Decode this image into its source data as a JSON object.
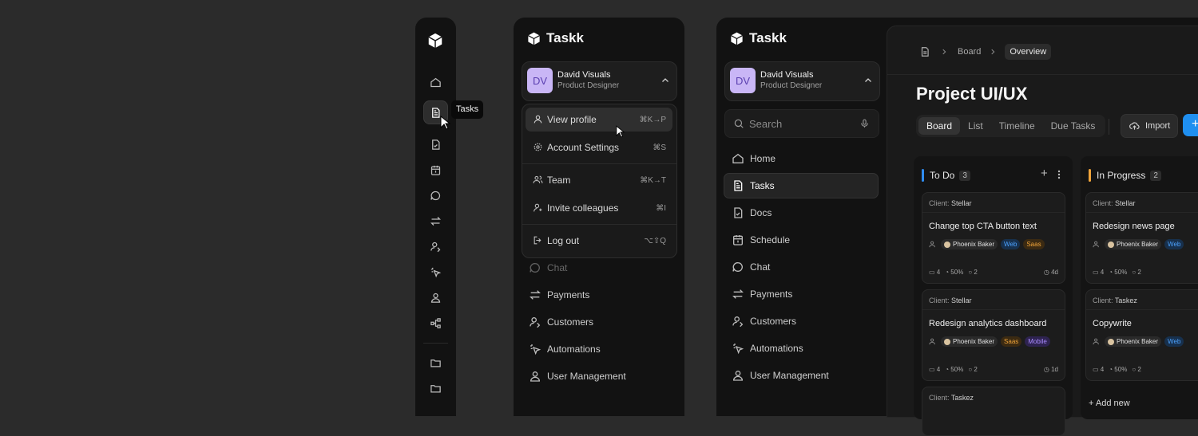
{
  "tooltip": "Tasks",
  "brand": {
    "name": "Taskk"
  },
  "account": {
    "initials": "DV",
    "name": "David Visuals",
    "role": "Product Designer"
  },
  "dropdown": [
    {
      "label": "View profile",
      "shortcut": "⌘K→P"
    },
    {
      "label": "Account Settings",
      "shortcut": "⌘S"
    },
    {
      "label": "Team",
      "shortcut": "⌘K→T"
    },
    {
      "label": "Invite colleagues",
      "shortcut": "⌘I"
    },
    {
      "label": "Log out",
      "shortcut": "⌥⇧Q"
    }
  ],
  "panel2_nav": [
    "Chat",
    "Payments",
    "Customers",
    "Automations",
    "User Management"
  ],
  "search": {
    "placeholder": "Search"
  },
  "nav": [
    "Home",
    "Tasks",
    "Docs",
    "Schedule",
    "Chat",
    "Payments",
    "Customers",
    "Automations",
    "User Management"
  ],
  "breadcrumb": [
    "Board",
    "Overview"
  ],
  "page_title": "Project UI/UX",
  "view_tabs": [
    "Board",
    "List",
    "Timeline",
    "Due Tasks"
  ],
  "import_label": "Import",
  "add_label": "+",
  "columns": [
    {
      "name": "To Do",
      "count": "3",
      "color": "#2f8cf0",
      "cards": [
        {
          "client_label": "Client:",
          "client": "Stellar",
          "title": "Change top CTA button text",
          "assignee": "Phoenix Baker",
          "tags": [
            {
              "label": "Web",
              "bg": "#17304d",
              "fg": "#4da3ff"
            },
            {
              "label": "Saas",
              "bg": "#3b2a12",
              "fg": "#f0a43a"
            }
          ],
          "files": "4",
          "progress": "50%",
          "comments": "2",
          "due": "4d"
        },
        {
          "client_label": "Client:",
          "client": "Stellar",
          "title": "Redesign analytics dashboard",
          "assignee": "Phoenix Baker",
          "tags": [
            {
              "label": "Saas",
              "bg": "#3b2a12",
              "fg": "#f0a43a"
            },
            {
              "label": "Mobile",
              "bg": "#2e2350",
              "fg": "#a98bff"
            }
          ],
          "files": "4",
          "progress": "50%",
          "comments": "2",
          "due": "1d"
        },
        {
          "client_label": "Client:",
          "client": "Taskez"
        }
      ]
    },
    {
      "name": "In Progress",
      "count": "2",
      "color": "#f0a43a",
      "cards": [
        {
          "client_label": "Client:",
          "client": "Stellar",
          "title": "Redesign news page",
          "assignee": "Phoenix Baker",
          "tags": [
            {
              "label": "Web",
              "bg": "#17304d",
              "fg": "#4da3ff"
            }
          ],
          "files": "4",
          "progress": "50%",
          "comments": "2"
        },
        {
          "client_label": "Client:",
          "client": "Taskez",
          "title": "Copywrite",
          "assignee": "Phoenix Baker",
          "tags": [
            {
              "label": "Web",
              "bg": "#17304d",
              "fg": "#4da3ff"
            }
          ],
          "files": "4",
          "progress": "50%",
          "comments": "2"
        }
      ],
      "add_new": "Add new"
    }
  ]
}
